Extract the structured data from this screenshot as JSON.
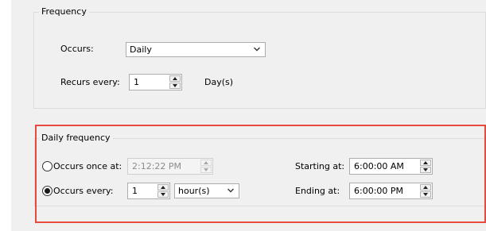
{
  "frequency": {
    "legend": "Frequency",
    "occurs_label": "Occurs:",
    "occurs_value": "Daily",
    "recurs_label": "Recurs every:",
    "recurs_value": "1",
    "recurs_unit": "Day(s)"
  },
  "daily_frequency": {
    "legend": "Daily frequency",
    "once_label": "Occurs once at:",
    "once_value": "2:12:22 PM",
    "once_selected": false,
    "every_label": "Occurs every:",
    "every_value": "1",
    "every_unit": "hour(s)",
    "every_selected": true,
    "starting_label": "Starting at:",
    "starting_value": "6:00:00 AM",
    "ending_label": "Ending at:",
    "ending_value": "6:00:00 PM"
  },
  "colors": {
    "highlight_border": "#e84a3f",
    "dialog_background": "#f0f0f0"
  },
  "icons": [
    "chevron-down-icon",
    "spin-up-icon",
    "spin-down-icon"
  ]
}
